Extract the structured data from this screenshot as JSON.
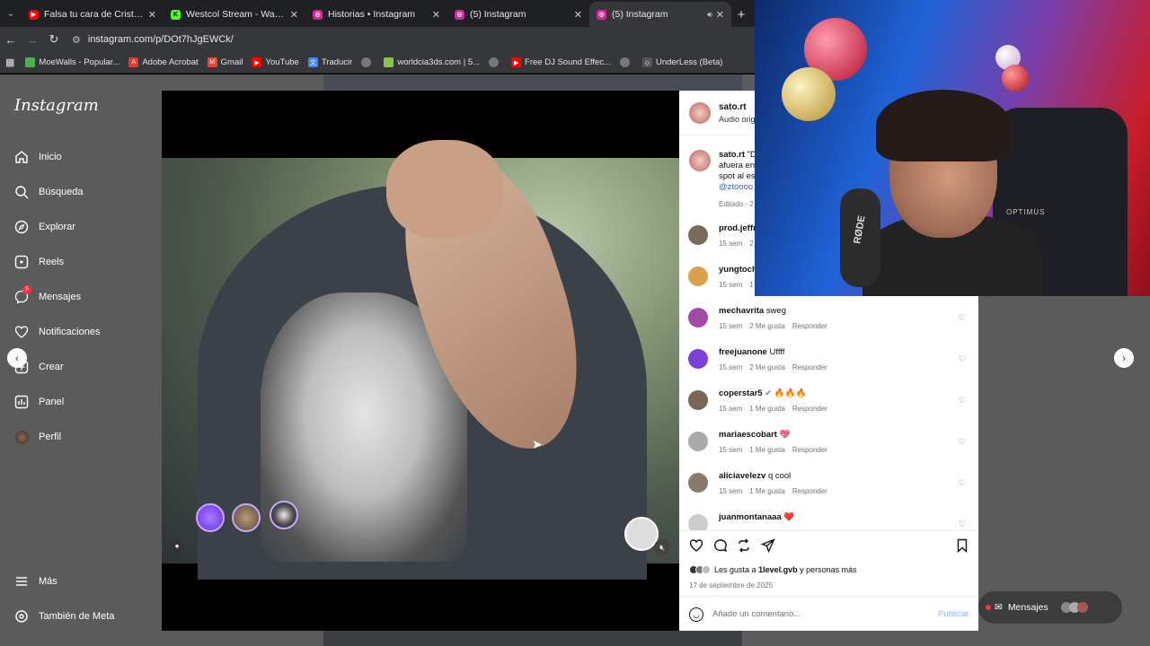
{
  "browser": {
    "tabs": [
      {
        "title": "Falsa tu cara de Cristo - YouTube",
        "favicon_color": "#ff0000",
        "favicon_glyph": "▶"
      },
      {
        "title": "Westcol Stream - Watch Live on Kick",
        "favicon_color": "#53fc18",
        "favicon_glyph": "K"
      },
      {
        "title": "Historias • Instagram",
        "favicon_color": "#d6249f",
        "favicon_glyph": "◎"
      },
      {
        "title": "(5) Instagram",
        "favicon_color": "#d6249f",
        "favicon_glyph": "◎"
      },
      {
        "title": "(5) Instagram",
        "favicon_color": "#d6249f",
        "favicon_glyph": "◎"
      }
    ],
    "url": "instagram.com/p/DOt7hJgEWCk/",
    "bookmarks": [
      {
        "label": "MoeWalls - Popular...",
        "color": "#4caf50"
      },
      {
        "label": "Adobe Acrobat",
        "color": "#e53935"
      },
      {
        "label": "Gmail",
        "color": "#ea4335"
      },
      {
        "label": "",
        "color": "#ff0000"
      },
      {
        "label": "YouTube",
        "color": "#ff0000"
      },
      {
        "label": "Traducir",
        "color": "#4285f4"
      },
      {
        "label": "",
        "color": "#9e9e9e"
      },
      {
        "label": "worldcia3ds.com | 5...",
        "color": "#8bc34a"
      },
      {
        "label": "",
        "color": "#9e9e9e"
      },
      {
        "label": "Free DJ Sound Effec...",
        "color": "#ff0000"
      },
      {
        "label": "",
        "color": "#9e9e9e"
      },
      {
        "label": "UnderLess (Beta)",
        "color": "#9e9e9e"
      }
    ]
  },
  "instagram": {
    "logo": "Instagram",
    "nav": [
      {
        "label": "Inicio",
        "icon": "home-icon"
      },
      {
        "label": "Búsqueda",
        "icon": "search-icon"
      },
      {
        "label": "Explorar",
        "icon": "compass-icon"
      },
      {
        "label": "Reels",
        "icon": "reels-icon"
      },
      {
        "label": "Mensajes",
        "icon": "messenger-icon",
        "badge": "5"
      },
      {
        "label": "Notificaciones",
        "icon": "heart-icon"
      },
      {
        "label": "Crear",
        "icon": "plus-icon"
      },
      {
        "label": "Panel",
        "icon": "chart-icon"
      },
      {
        "label": "Perfil",
        "icon": "avatar-icon"
      }
    ],
    "bottom_nav": [
      {
        "label": "Más",
        "icon": "menu-icon"
      },
      {
        "label": "También de Meta",
        "icon": "meta-icon"
      }
    ],
    "post": {
      "username": "sato.rt",
      "audio": "Audio origi",
      "caption_user": "sato.rt",
      "caption_lines": [
        "\"D",
        "afuera en",
        "spot al es",
        "@ztoooo"
      ],
      "edited": "Editado · 2"
    },
    "comments": [
      {
        "user": "prod.jeffr",
        "text": "",
        "time": "15 sem",
        "likes": "2",
        "reply": ""
      },
      {
        "user": "yungtoch",
        "text": "",
        "time": "15 sem",
        "likes": "1",
        "reply": ""
      },
      {
        "user": "mechavrita",
        "text": "sweg",
        "time": "15 sem",
        "likes": "2 Me gusta",
        "reply": "Responder"
      },
      {
        "user": "freejuanone",
        "text": "Uffff",
        "time": "15 sem",
        "likes": "2 Me gusta",
        "reply": "Responder"
      },
      {
        "user": "coperstar5",
        "text": "🔥🔥🔥",
        "time": "15 sem",
        "likes": "1 Me gusta",
        "reply": "Responder",
        "verified": true
      },
      {
        "user": "mariaescobart",
        "text": "💖",
        "time": "15 sem",
        "likes": "1 Me gusta",
        "reply": "Responder"
      },
      {
        "user": "aliciavelezv",
        "text": "q cool",
        "time": "15 sem",
        "likes": "1 Me gusta",
        "reply": "Responder"
      },
      {
        "user": "juanmontanaaa",
        "text": "❤️",
        "time": "",
        "likes": "",
        "reply": ""
      }
    ],
    "likes_text_pre": "Les gusta a",
    "likes_user": "1level.gvb",
    "likes_text_post": "y personas más",
    "date": "17 de septiembre de 2025",
    "add_comment_placeholder": "Añade un comentario...",
    "publish": "Publicar",
    "messages_pill": "Mensajes"
  },
  "webcam": {
    "mic_brand": "RØDE",
    "chair_brand": "OPTIMUS"
  }
}
